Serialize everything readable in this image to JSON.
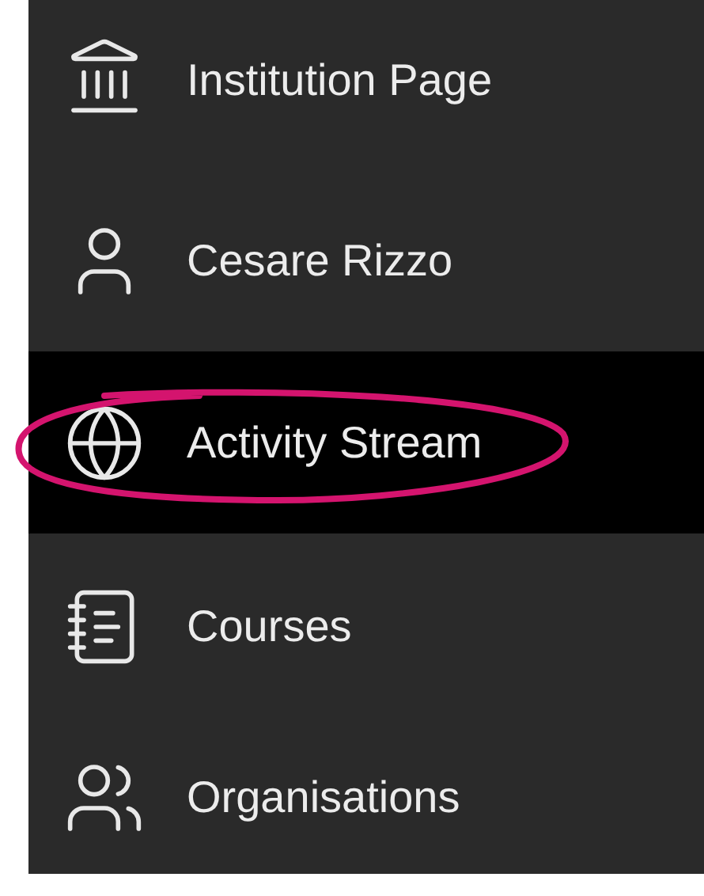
{
  "sidebar": {
    "items": [
      {
        "label": "Institution Page",
        "kind": "institution",
        "selected": false,
        "circled": false
      },
      {
        "label": "Cesare Rizzo",
        "kind": "profile",
        "selected": false,
        "circled": false
      },
      {
        "label": "Activity Stream",
        "kind": "stream",
        "selected": true,
        "circled": true
      },
      {
        "label": "Courses",
        "kind": "courses",
        "selected": false,
        "circled": false
      },
      {
        "label": "Organisations",
        "kind": "organisations",
        "selected": false,
        "circled": false
      }
    ]
  }
}
